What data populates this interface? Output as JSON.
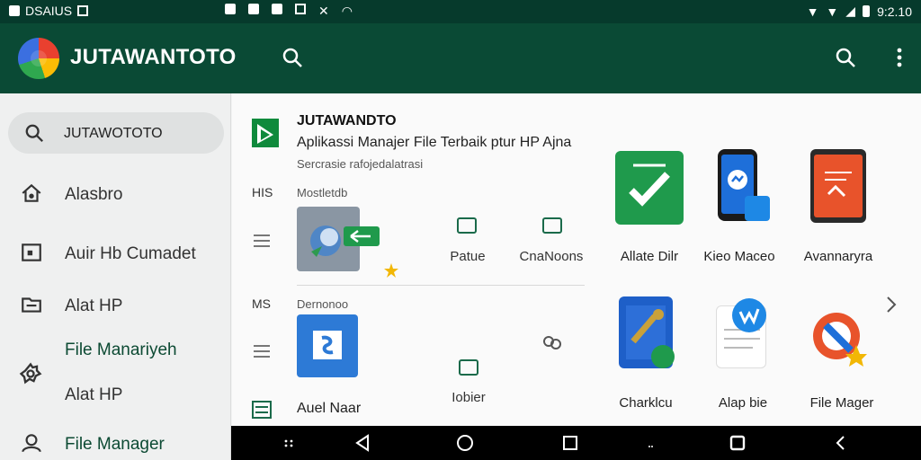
{
  "status_bar": {
    "left_text": "DSAIUS",
    "time": "9:2.10"
  },
  "app_bar": {
    "title": "JUTAWANTOTO"
  },
  "sidebar": {
    "search_text": "JUTAWOTOTO",
    "items": [
      {
        "label": "Alasbro",
        "icon": "home-icon"
      },
      {
        "label": "Auir Hb Cumadet",
        "icon": "image-icon"
      },
      {
        "label": "Alat HP",
        "icon": "folder-icon"
      },
      {
        "label": "File Manariyeh",
        "icon": "gear-icon"
      },
      {
        "label": "Alat HP",
        "icon": ""
      },
      {
        "label": "File Manager",
        "icon": "person-icon"
      }
    ]
  },
  "header": {
    "title": "JUTAWANDTO",
    "subtitle": "Aplikassi Manajer File Terbaik ptur HP Ajna",
    "description": "Sercrasie rafojedalatrasi"
  },
  "section1": {
    "code": "HIS",
    "name": "Mostletdb",
    "actions": [
      {
        "label": "Patue"
      },
      {
        "label": "CnaNoons"
      }
    ]
  },
  "section2": {
    "code": "MS",
    "name": "Dernonoo",
    "app_label": "Auel Naar",
    "action_label": "Iobier"
  },
  "apps_row1": [
    {
      "label": "Allate Dilr",
      "color": "#1f9a4c"
    },
    {
      "label": "Kieo Maceo",
      "color": "#1e6fd9"
    },
    {
      "label": "Avannaryra",
      "color": "#e8532b"
    }
  ],
  "apps_row2": [
    {
      "label": "Charklcu",
      "color": "#1e5fc8"
    },
    {
      "label": "Alap bie",
      "color": "#1e88e5"
    },
    {
      "label": "File Mager",
      "color": "#e8532b"
    }
  ]
}
